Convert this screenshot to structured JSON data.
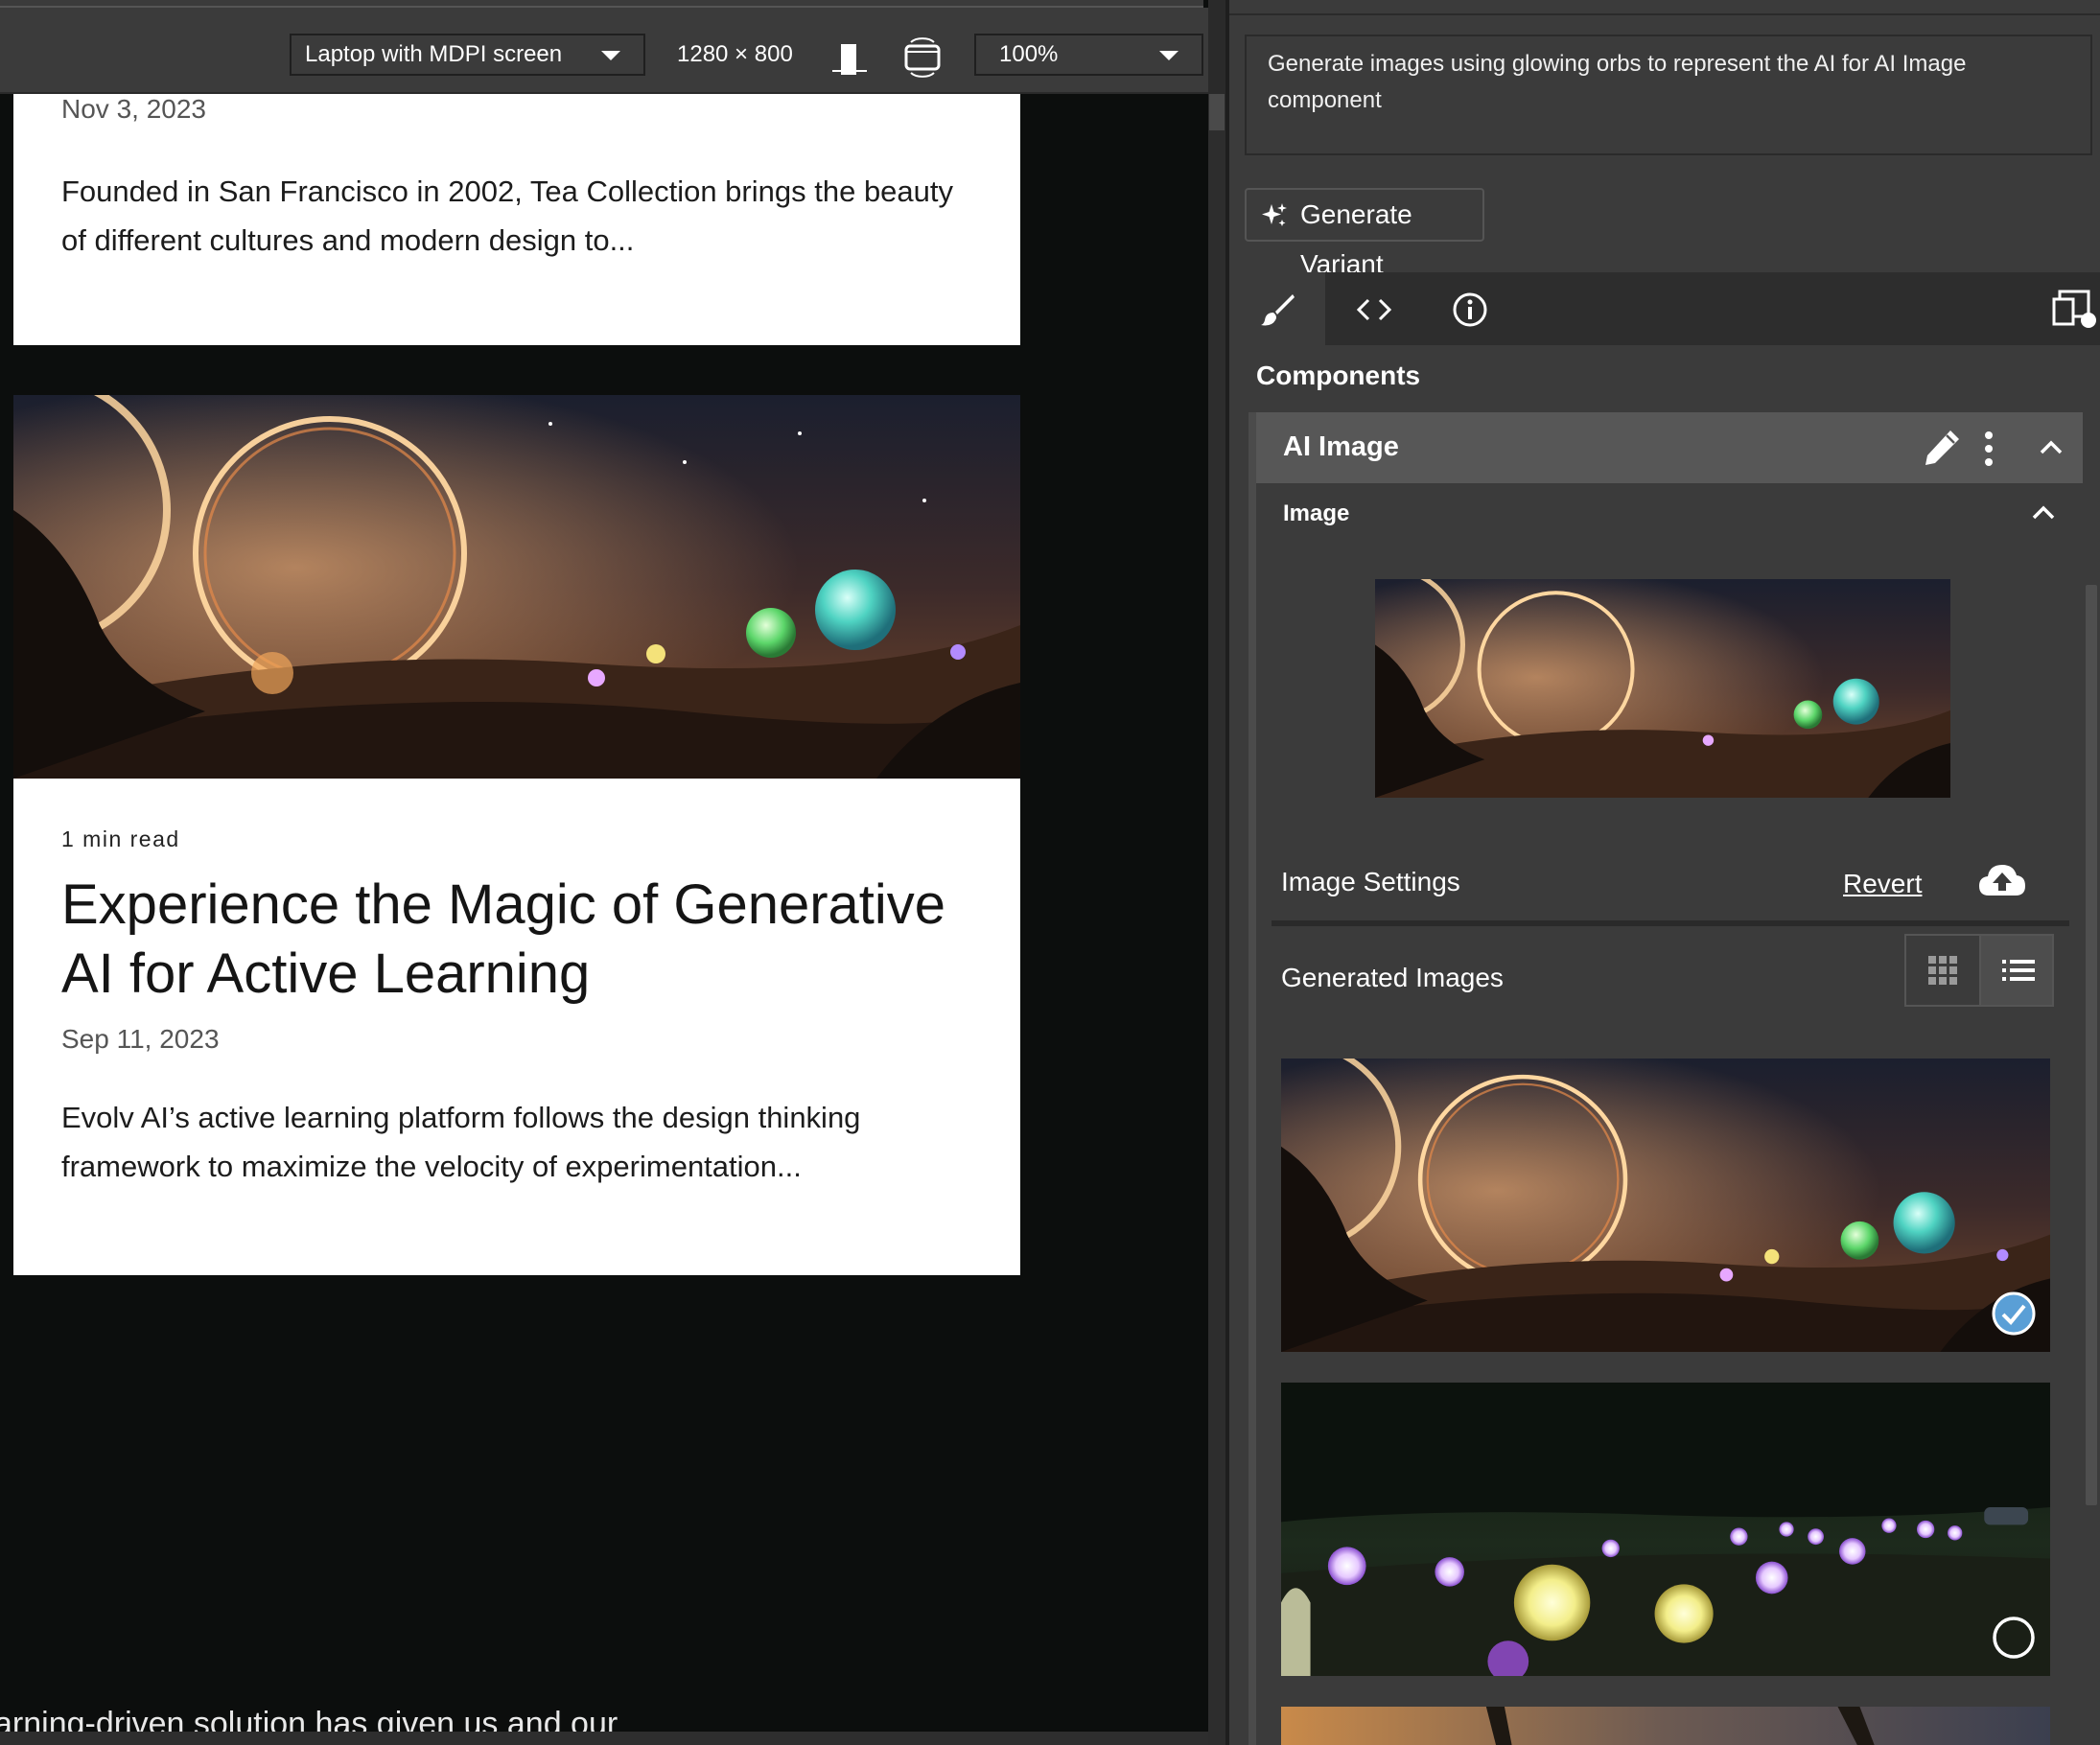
{
  "toolbar": {
    "device": "Laptop with MDPI screen",
    "dimensions": "1280 × 800",
    "zoom": "100%"
  },
  "canvas": {
    "card1": {
      "date": "Nov 3, 2023",
      "excerpt": "Founded in San Francisco in 2002, Tea Collection brings the beauty of different cultures and modern design to..."
    },
    "card2": {
      "read_time": "1 min read",
      "title": "Experience the Magic of Generative AI for Active Learning",
      "date": "Sep 11, 2023",
      "excerpt": "Evolv AI’s active learning platform follows the design thinking framework to maximize the velocity of experimentation..."
    },
    "cut_text": "arning-driven solution has given us and our"
  },
  "panel": {
    "prompt": "Generate images using glowing orbs to represent the AI for AI Image component",
    "generate_button": "Generate Variant",
    "tabs": [
      {
        "icon": "paintbrush-icon",
        "active": true
      },
      {
        "icon": "code-icon",
        "active": false
      },
      {
        "icon": "info-icon",
        "active": false
      }
    ],
    "section_title": "Components",
    "component": {
      "title": "AI Image",
      "image_section_title": "Image",
      "settings_label": "Image Settings",
      "revert_label": "Revert",
      "generated_label": "Generated Images",
      "view_mode": "list",
      "generated_images": [
        {
          "scene": "glowing-rings-night-sky",
          "selected": true
        },
        {
          "scene": "glowing-orbs-forest-meadow",
          "selected": false
        },
        {
          "scene": "sunset-trees",
          "selected": false
        }
      ]
    }
  },
  "colors": {
    "panel_bg": "#3b3b3b",
    "canvas_bg": "#0c0e0d",
    "card_bg": "#ffffff",
    "check_blue": "#5a9fd6"
  }
}
